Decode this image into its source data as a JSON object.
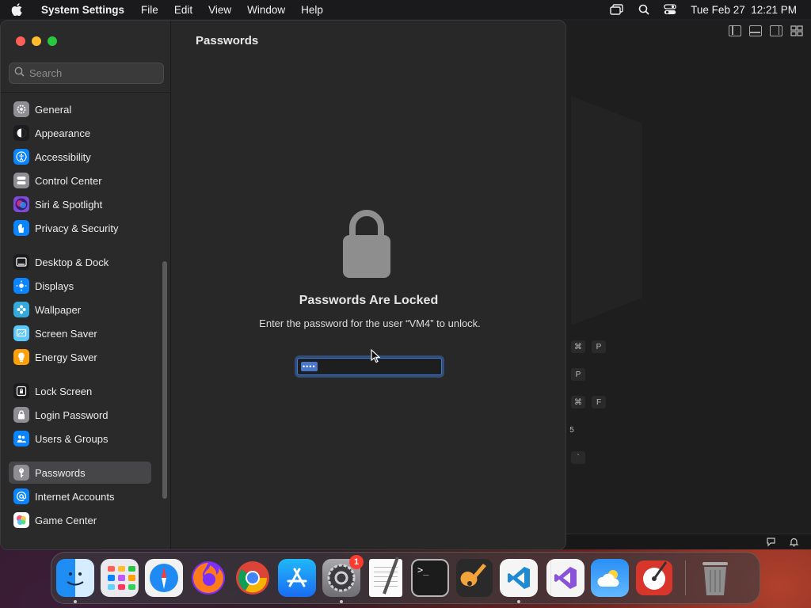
{
  "menubar": {
    "app_name": "System Settings",
    "menus": [
      "File",
      "Edit",
      "View",
      "Window",
      "Help"
    ],
    "datetime": "Tue Feb 27  12:21 PM",
    "status_icons": [
      "screen-mirroring-icon",
      "spotlight-search-icon",
      "control-center-icon"
    ]
  },
  "window": {
    "title": "Passwords",
    "search_placeholder": "Search",
    "sidebar": {
      "items": [
        {
          "label": "General",
          "icon": "gear-icon",
          "color": "#8e8e93"
        },
        {
          "label": "Appearance",
          "icon": "appearance-icon",
          "color": "#1c1c1e"
        },
        {
          "label": "Accessibility",
          "icon": "accessibility-icon",
          "color": "#0a84ff"
        },
        {
          "label": "Control Center",
          "icon": "control-center-icon",
          "color": "#8e8e93"
        },
        {
          "label": "Siri & Spotlight",
          "icon": "siri-icon",
          "color": "#7d4bd8"
        },
        {
          "label": "Privacy & Security",
          "icon": "hand-icon",
          "color": "#0a84ff"
        },
        {
          "label": "Desktop & Dock",
          "icon": "dock-icon",
          "color": "#1c1c1e"
        },
        {
          "label": "Displays",
          "icon": "sun-icon",
          "color": "#0a84ff"
        },
        {
          "label": "Wallpaper",
          "icon": "flower-icon",
          "color": "#34aadc"
        },
        {
          "label": "Screen Saver",
          "icon": "screen-saver-icon",
          "color": "#5ac8fa"
        },
        {
          "label": "Energy Saver",
          "icon": "battery-icon",
          "color": "#ff9f0a"
        },
        {
          "label": "Lock Screen",
          "icon": "lock-screen-icon",
          "color": "#1c1c1e"
        },
        {
          "label": "Login Password",
          "icon": "lock-icon",
          "color": "#8e8e93"
        },
        {
          "label": "Users & Groups",
          "icon": "users-icon",
          "color": "#0a84ff"
        },
        {
          "label": "Passwords",
          "icon": "key-icon",
          "color": "#8e8e93",
          "active": true
        },
        {
          "label": "Internet Accounts",
          "icon": "at-icon",
          "color": "#0a84ff"
        },
        {
          "label": "Game Center",
          "icon": "game-center-icon",
          "color": "#ffffff"
        }
      ]
    },
    "locked": {
      "heading": "Passwords Are Locked",
      "message": "Enter the password for the user “VM4” to unlock.",
      "password_value": "••••"
    }
  },
  "background_window": {
    "shortcuts": [
      [
        "⌘",
        "P"
      ],
      [
        "P"
      ],
      [
        "⌘",
        "F"
      ],
      [
        "5"
      ],
      [
        "`"
      ]
    ]
  },
  "dock": {
    "apps": [
      {
        "name": "Finder",
        "icon": "finder-icon",
        "running": true
      },
      {
        "name": "Launchpad",
        "icon": "launchpad-icon",
        "running": false
      },
      {
        "name": "Safari",
        "icon": "safari-icon",
        "running": false
      },
      {
        "name": "Firefox",
        "icon": "firefox-icon",
        "running": false
      },
      {
        "name": "Chrome",
        "icon": "chrome-icon",
        "running": false
      },
      {
        "name": "App Store",
        "icon": "app-store-icon",
        "running": false
      },
      {
        "name": "System Settings",
        "icon": "system-settings-icon",
        "running": true,
        "badge": "1"
      },
      {
        "name": "TextEdit",
        "icon": "textedit-icon",
        "running": false
      },
      {
        "name": "Terminal",
        "icon": "terminal-icon",
        "running": false
      },
      {
        "name": "GarageBand",
        "icon": "garageband-icon",
        "running": false
      },
      {
        "name": "Visual Studio Code",
        "icon": "vscode-icon",
        "running": true
      },
      {
        "name": "Visual Studio",
        "icon": "visual-studio-icon",
        "running": false
      },
      {
        "name": "Weather",
        "icon": "weather-icon",
        "running": false
      },
      {
        "name": "Instruments",
        "icon": "instruments-icon",
        "running": false
      },
      {
        "name": "Trash",
        "icon": "trash-icon",
        "running": false
      }
    ]
  }
}
